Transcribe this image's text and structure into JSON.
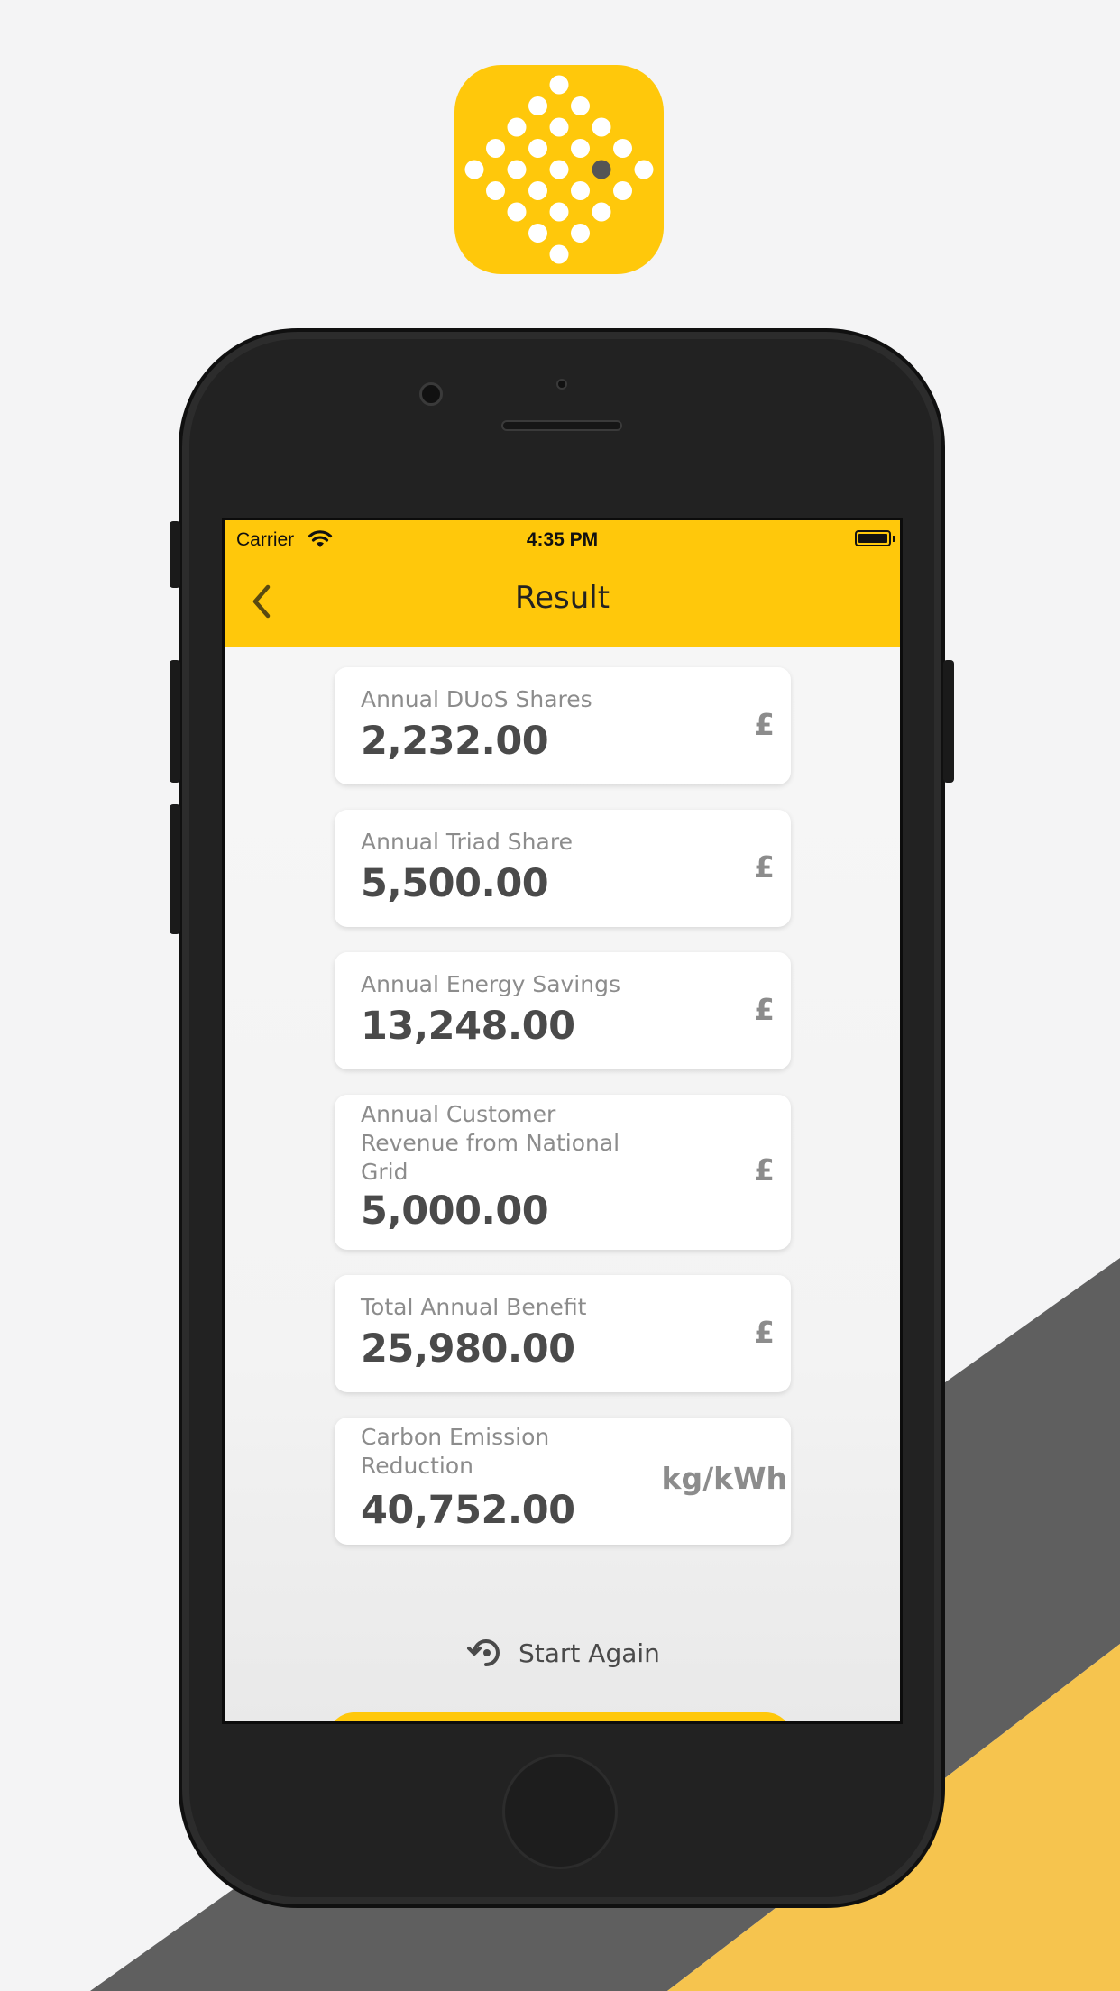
{
  "status_bar": {
    "carrier": "Carrier",
    "time": "4:35 PM"
  },
  "nav": {
    "title": "Result",
    "back_icon": "chevron-left-icon"
  },
  "results": [
    {
      "label": "Annual DUoS Shares",
      "value": "2,232.00",
      "unit": "£"
    },
    {
      "label": "Annual Triad Share",
      "value": "5,500.00",
      "unit": "£"
    },
    {
      "label": "Annual Energy Savings",
      "value": "13,248.00",
      "unit": "£"
    },
    {
      "label": "Annual Customer Revenue from National Grid",
      "value": "5,000.00",
      "unit": "£"
    },
    {
      "label": "Total Annual Benefit",
      "value": "25,980.00",
      "unit": "£"
    },
    {
      "label": "Carbon Emission Reduction",
      "value": "40,752.00",
      "unit": "kg/kWh"
    }
  ],
  "actions": {
    "start_again": "Start Again",
    "start_again_icon": "restart-icon"
  },
  "colors": {
    "brand_yellow": "#ffc80b",
    "stripe_dark": "#5f5f5f",
    "stripe_yellow": "#f6c44e",
    "text_dark": "#4a4a4a",
    "text_muted": "#8c8c8c"
  }
}
